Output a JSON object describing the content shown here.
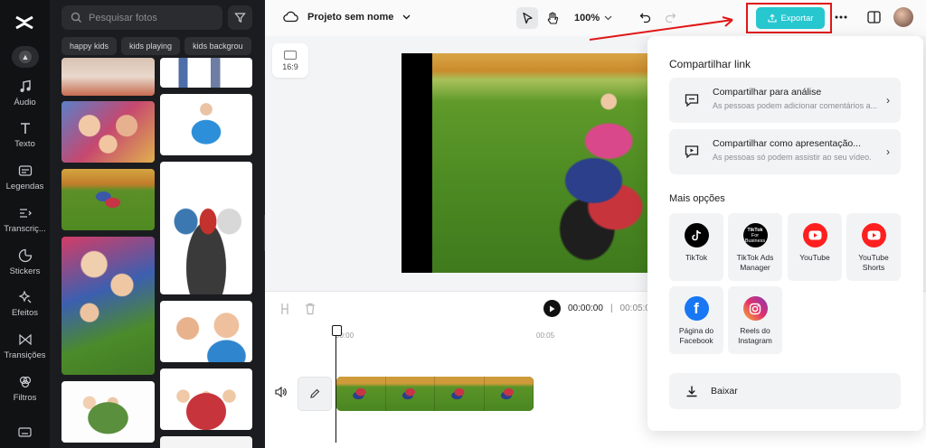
{
  "colors": {
    "accent": "#27c7d0",
    "annotation": "#e11616",
    "rail_bg": "#111214",
    "panel_bg": "#1b1c1f"
  },
  "rail": {
    "items": [
      {
        "label": "Áudio",
        "icon": "music-note-icon"
      },
      {
        "label": "Texto",
        "icon": "text-icon"
      },
      {
        "label": "Legendas",
        "icon": "captions-icon"
      },
      {
        "label": "Transcriç...",
        "icon": "transcript-icon"
      },
      {
        "label": "Stickers",
        "icon": "sticker-icon"
      },
      {
        "label": "Efeitos",
        "icon": "effects-icon"
      },
      {
        "label": "Transições",
        "icon": "transition-icon"
      },
      {
        "label": "Filtros",
        "icon": "filter-icon"
      }
    ]
  },
  "media": {
    "search_placeholder": "Pesquisar fotos",
    "chips": [
      "happy kids",
      "kids playing",
      "kids backgrou"
    ]
  },
  "topbar": {
    "project_name": "Projeto sem nome",
    "zoom": "100%",
    "export_label": "Exportar"
  },
  "canvas": {
    "ratio_label": "16:9"
  },
  "timeline": {
    "current_time": "00:00:00",
    "total_time": "00:05:0",
    "ruler": [
      "00:00",
      "00:05"
    ]
  },
  "share": {
    "title": "Compartilhar link",
    "options": [
      {
        "title": "Compartilhar para análise",
        "desc": "As pessoas podem adicionar comentários a..."
      },
      {
        "title": "Compartilhar como apresentação...",
        "desc": "As pessoas só podem assistir ao seu vídeo."
      }
    ],
    "more_title": "Mais opções",
    "platforms": [
      {
        "label": "TikTok"
      },
      {
        "label": "TikTok Ads Manager"
      },
      {
        "label": "YouTube"
      },
      {
        "label": "YouTube Shorts"
      },
      {
        "label": "Página do Facebook"
      },
      {
        "label": "Reels do Instagram"
      }
    ],
    "download_label": "Baixar"
  }
}
